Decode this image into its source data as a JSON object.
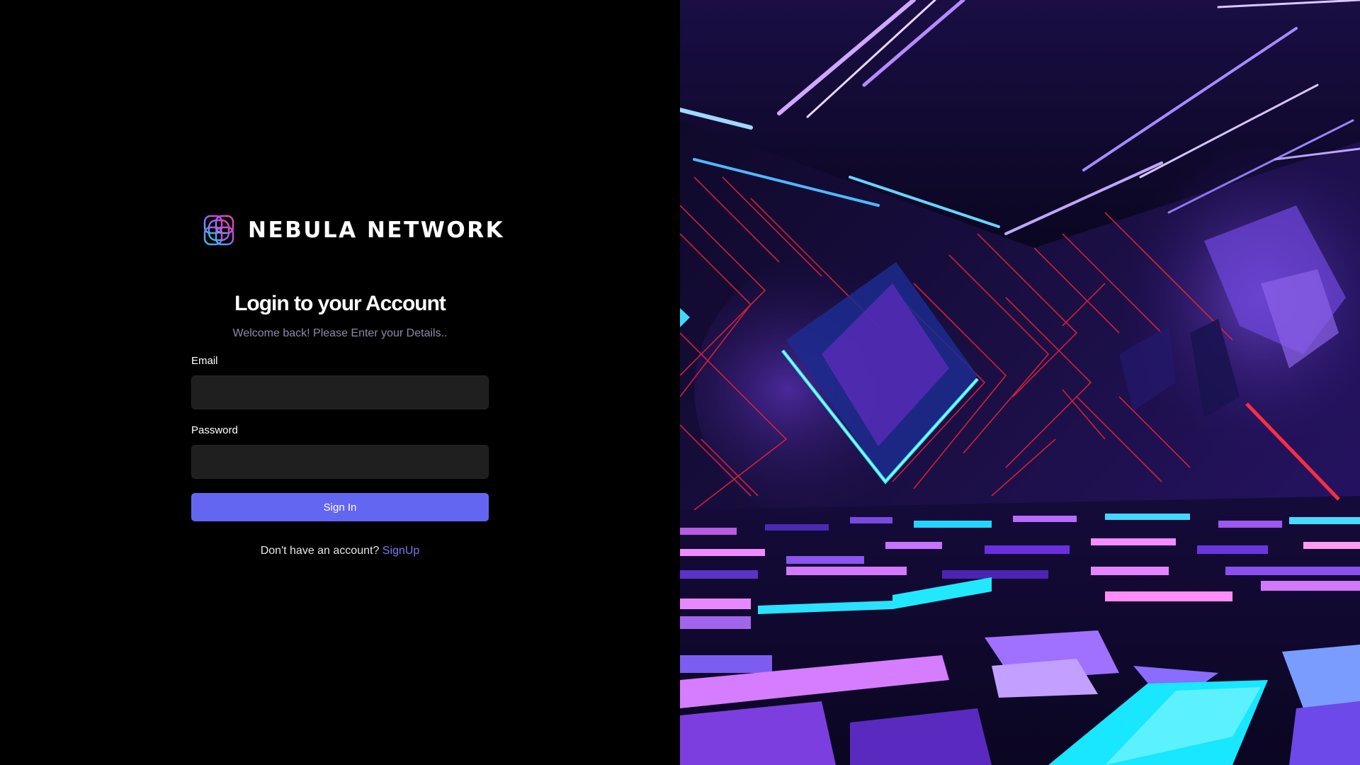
{
  "brand": {
    "name": "NEBULA NETWORK",
    "logo_icon": "knot-logo-icon"
  },
  "login": {
    "title": "Login to your Account",
    "subtitle": "Welcome back! Please Enter your Details..",
    "email": {
      "label": "Email",
      "value": ""
    },
    "password": {
      "label": "Password",
      "value": ""
    },
    "submit_label": "Sign In",
    "signup_prompt": "Don't have an account?",
    "signup_link": "SignUp"
  },
  "colors": {
    "background": "#000000",
    "input_background": "#1f1f1f",
    "accent": "#6366f1",
    "link": "#7b78f0",
    "subtitle": "#8e8aa8",
    "logo_gradient": [
      "#22d3ee",
      "#a855f7",
      "#ec4899"
    ]
  },
  "hero_image": {
    "icon": "neon-geometric-room-illustration"
  }
}
